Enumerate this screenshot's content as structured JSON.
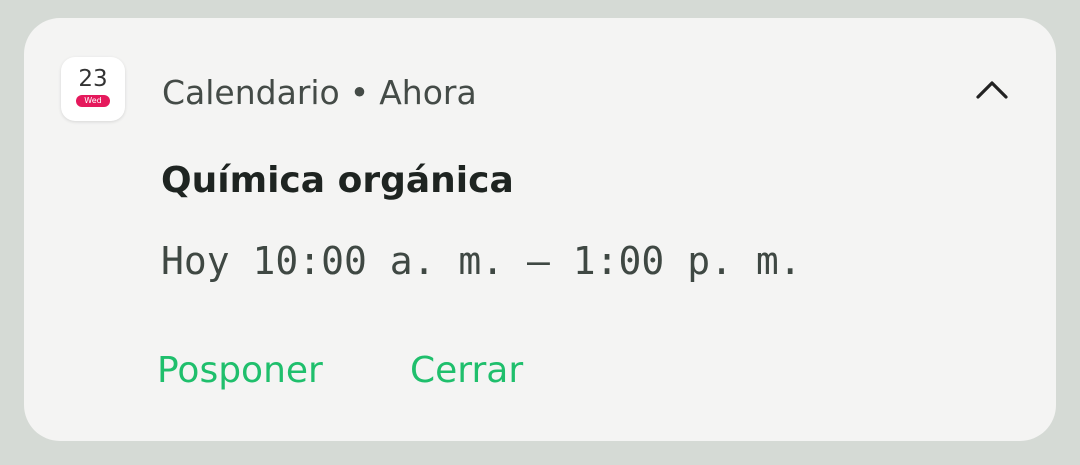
{
  "notification": {
    "app_icon": {
      "day": "23",
      "weekday": "Wed",
      "badge_color": "#e5195c"
    },
    "app_name": "Calendario",
    "separator": "•",
    "time_ago": "Ahora",
    "collapse_icon": "chevron-up-icon",
    "title": "Química orgánica",
    "time_range": "Hoy 10:00 a. m. – 1:00 p. m.",
    "actions": {
      "snooze_label": "Posponer",
      "close_label": "Cerrar"
    },
    "accent_color": "#1fbf6c"
  }
}
